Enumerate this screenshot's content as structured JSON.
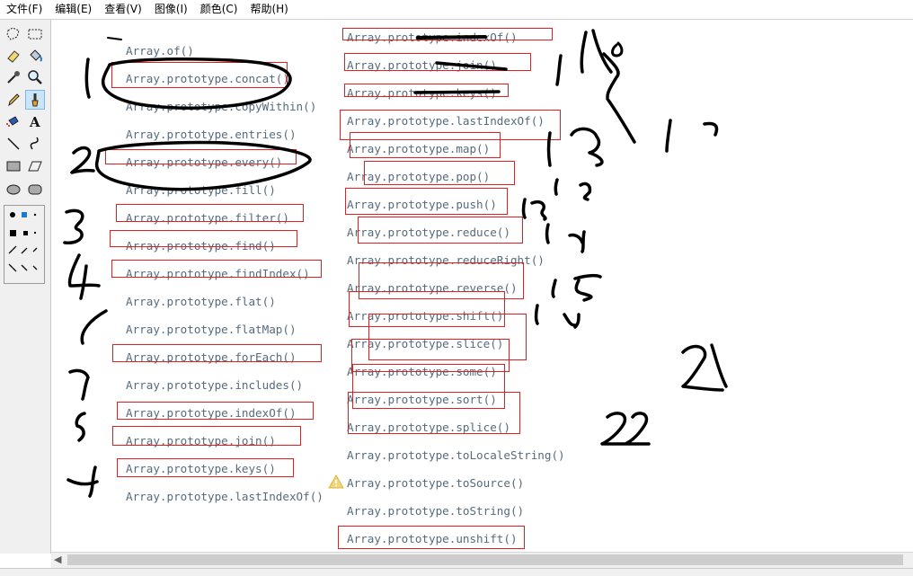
{
  "menu": [
    "文件(F)",
    "编辑(E)",
    "查看(V)",
    "图像(I)",
    "颜色(C)",
    "帮助(H)"
  ],
  "left_column": [
    "Array.of()",
    "Array.prototype.concat()",
    "Array.prototype.copyWithin()",
    "Array.prototype.entries()",
    "Array.prototype.every()",
    "Array.prototype.fill()",
    "Array.prototype.filter()",
    "Array.prototype.find()",
    "Array.prototype.findIndex()",
    "Array.prototype.flat()",
    "Array.prototype.flatMap()",
    "Array.prototype.forEach()",
    "Array.prototype.includes()",
    "Array.prototype.indexOf()",
    "Array.prototype.join()",
    "Array.prototype.keys()",
    "Array.prototype.lastIndexOf()"
  ],
  "right_column": [
    "Array.prototype.indexOf()",
    "Array.prototype.join()",
    "Array.prototype.keys()",
    "Array.prototype.lastIndexOf()",
    "Array.prototype.map()",
    "Array.prototype.pop()",
    "Array.prototype.push()",
    "Array.prototype.reduce()",
    "Array.prototype.reduceRight()",
    "Array.prototype.reverse()",
    "Array.prototype.shift()",
    "Array.prototype.slice()",
    "Array.prototype.some()",
    "Array.prototype.sort()",
    "Array.prototype.splice()",
    "Array.prototype.toLocaleString()",
    "Array.prototype.toSource()",
    "Array.prototype.toString()",
    "Array.prototype.unshift()"
  ],
  "tools": [
    "free-form-select-icon",
    "rect-select-icon",
    "eraser-icon",
    "fill-icon",
    "color-picker-icon",
    "magnifier-icon",
    "pencil-icon",
    "brush-icon",
    "airbrush-icon",
    "text-icon",
    "line-icon",
    "curve-icon",
    "rectangle-icon",
    "polygon-icon",
    "ellipse-icon",
    "rounded-rect-icon"
  ],
  "colors": {
    "code_text": "#566b7d",
    "box": "#e02020",
    "ink": "#000000",
    "active_tool": "#cce4f7"
  }
}
